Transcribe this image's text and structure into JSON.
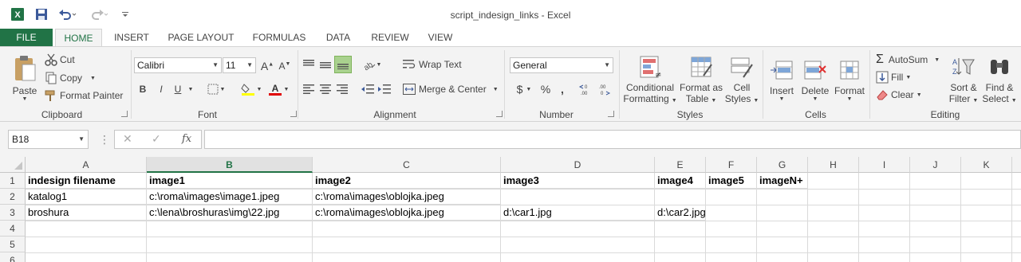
{
  "window": {
    "title": "script_indesign_links - Excel"
  },
  "quick_access": {
    "app_icon": "excel-logo-icon",
    "save_icon": "save-icon",
    "undo_icon": "undo-icon",
    "redo_icon": "redo-icon",
    "customize_icon": "customize-qat-icon"
  },
  "tabs": [
    "FILE",
    "HOME",
    "INSERT",
    "PAGE LAYOUT",
    "FORMULAS",
    "DATA",
    "REVIEW",
    "VIEW"
  ],
  "ribbon": {
    "clipboard": {
      "label": "Clipboard",
      "paste": "Paste",
      "cut": "Cut",
      "copy": "Copy",
      "format_painter": "Format Painter"
    },
    "font": {
      "label": "Font",
      "font_name": "Calibri",
      "font_size": "11",
      "bold": "B",
      "italic": "I",
      "underline": "U"
    },
    "alignment": {
      "label": "Alignment",
      "wrap_text": "Wrap Text",
      "merge_center": "Merge & Center"
    },
    "number": {
      "label": "Number",
      "format": "General",
      "currency": "$",
      "percent": "%",
      "comma": ","
    },
    "styles": {
      "label": "Styles",
      "conditional_1": "Conditional",
      "conditional_2": "Formatting",
      "format_table_1": "Format as",
      "format_table_2": "Table",
      "cell_styles_1": "Cell",
      "cell_styles_2": "Styles"
    },
    "cells": {
      "label": "Cells",
      "insert": "Insert",
      "delete": "Delete",
      "format": "Format"
    },
    "editing": {
      "label": "Editing",
      "autosum": "AutoSum",
      "fill": "Fill",
      "clear": "Clear",
      "sort_1": "Sort &",
      "sort_2": "Filter",
      "find_1": "Find &",
      "find_2": "Select"
    }
  },
  "formula_bar": {
    "name_box": "B18",
    "formula": "",
    "cancel_glyph": "✕",
    "enter_glyph": "✓",
    "fx_glyph": "fx"
  },
  "sheet": {
    "columns": [
      "A",
      "B",
      "C",
      "D",
      "E",
      "F",
      "G",
      "H",
      "I",
      "J",
      "K"
    ],
    "selected_column": "B",
    "rows": [
      "1",
      "2",
      "3",
      "4",
      "5",
      "6"
    ],
    "cells": {
      "r1": [
        "indesign filename",
        "image1",
        "image2",
        "image3",
        "image4",
        "image5",
        "imageN+"
      ],
      "r2": [
        "katalog1",
        "c:\\roma\\images\\image1.jpeg",
        "c:\\roma\\images\\oblojka.jpeg",
        "",
        "",
        "",
        ""
      ],
      "r3": [
        "broshura",
        "c:\\lena\\broshuras\\img\\22.jpg",
        "c:\\roma\\images\\oblojka.jpeg",
        "d:\\car1.jpg",
        "d:\\car2.jpg",
        "",
        ""
      ]
    }
  },
  "colors": {
    "accent": "#217346",
    "ribbon_bg": "#f3f3f3"
  }
}
